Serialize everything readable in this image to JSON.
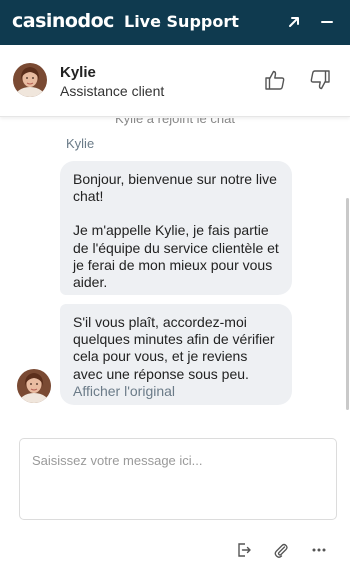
{
  "window": {
    "brand": "casinodoc",
    "title": "Live Support",
    "colors": {
      "topbar": "#0f3a4f",
      "bubble": "#eef0f3"
    },
    "icons": [
      "expand-icon",
      "minimize-icon"
    ]
  },
  "agent": {
    "name": "Kylie",
    "role": "Assistance client",
    "icons": [
      "avatar",
      "thumbs-up-icon",
      "thumbs-down-icon"
    ]
  },
  "conversation": {
    "system_message": "Kylie a rejoint le chat",
    "sender": "Kylie",
    "messages": [
      {
        "paragraphs": [
          "Bonjour, bienvenue sur notre live chat!",
          "Je m'appelle Kylie, je fais partie de l'équipe du service clientèle et je ferai de mon mieux pour vous aider."
        ]
      },
      {
        "text": "S'il vous plaît, accordez-moi quelques minutes afin de vérifier cela pour vous, et je reviens avec une réponse sous peu.",
        "link": "Afficher l'original"
      }
    ]
  },
  "composer": {
    "placeholder": "Saisissez votre message ici...",
    "value": "",
    "icons": [
      "transcript-icon",
      "paperclip-icon",
      "more-icon"
    ]
  }
}
